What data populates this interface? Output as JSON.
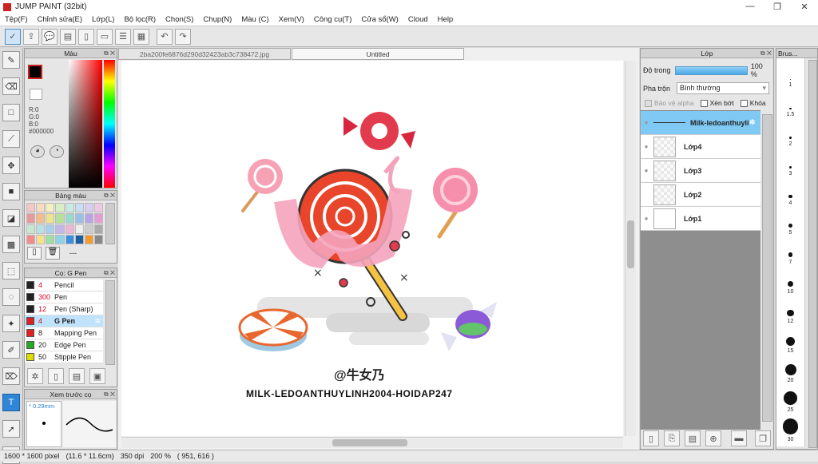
{
  "app": {
    "title": "JUMP PAINT (32bit)"
  },
  "menu": [
    "Tệp(F)",
    "Chỉnh sửa(E)",
    "Lớp(L)",
    "Bộ lọc(R)",
    "Chọn(S)",
    "Chụp(N)",
    "Màu (C)",
    "Xem(V)",
    "Công cụ(T)",
    "Cửa sổ(W)",
    "Cloud",
    "Help"
  ],
  "color_panel": {
    "title": "Màu",
    "r": "R:0",
    "g": "G:0",
    "b": "B:0",
    "hex": "#000000"
  },
  "swatch_panel": {
    "title": "Bảng màu",
    "footer": "---"
  },
  "brush_panel": {
    "title": "Cọ: G Pen",
    "brushes": [
      {
        "size": "4",
        "name": "Pencil",
        "color": "#222222"
      },
      {
        "size": "300",
        "name": "Pen",
        "color": "#222222"
      },
      {
        "size": "12",
        "name": "Pen (Sharp)",
        "color": "#222222"
      },
      {
        "size": "4",
        "name": "G Pen",
        "color": "#e02020"
      },
      {
        "size": "8",
        "name": "Mapping Pen",
        "color": "#e02020"
      },
      {
        "size": "20",
        "name": "Edge Pen",
        "color": "#22aa22"
      },
      {
        "size": "50",
        "name": "Stipple Pen",
        "color": "#dddd00"
      }
    ]
  },
  "preview_panel": {
    "title": "Xem trước cọ",
    "size": "* 0.29mm"
  },
  "tabs": {
    "file1": "2ba200fe6876d290d32423ab3c738472.jpg",
    "file2": "Untitled"
  },
  "artwork": {
    "handle": "@牛女乃",
    "caption": "MILK-LEDOANTHUYLINH2004-HOIDAP247"
  },
  "layer_panel": {
    "title": "Lớp",
    "opacity_label": "Độ trong",
    "opacity_value": "100 %",
    "blend_label": "Pha trộn",
    "blend_value": "Bình thường",
    "protect_alpha": "Bảo vệ alpha",
    "clipping": "Xén bớt",
    "lock": "Khóa",
    "layers": [
      {
        "name": "Milk-ledoanthuylinh"
      },
      {
        "name": "Lớp4"
      },
      {
        "name": "Lớp3"
      },
      {
        "name": "Lớp2"
      },
      {
        "name": "Lớp1"
      }
    ]
  },
  "brush_size_panel": {
    "title": "Brus...",
    "sizes": [
      "1",
      "1.5",
      "2",
      "3",
      "4",
      "5",
      "7",
      "10",
      "12",
      "15",
      "20",
      "25",
      "30"
    ]
  },
  "status": {
    "dims": "1600 * 1600 pixel",
    "cm": "(11.6 * 11.6cm)",
    "dpi": "350 dpi",
    "zoom": "200 %",
    "coords": "( 951, 616 )"
  }
}
